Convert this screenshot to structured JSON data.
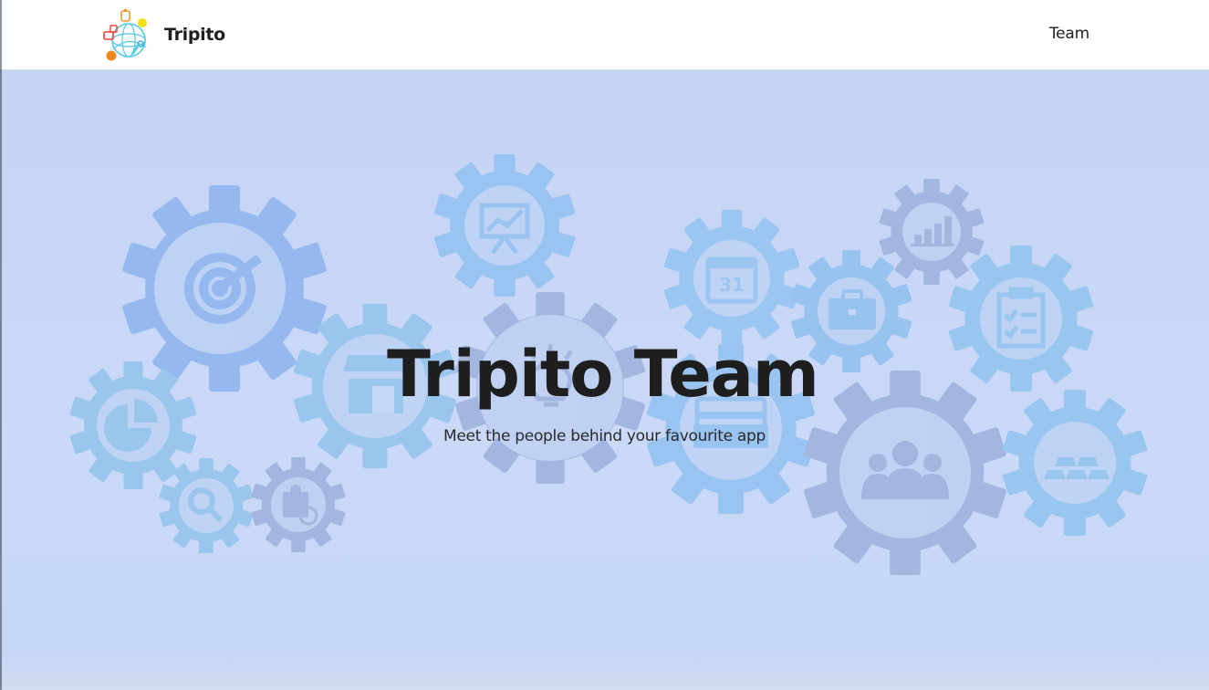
{
  "navbar": {
    "brand_name": "Tripito",
    "links": [
      {
        "label": "Team"
      }
    ]
  },
  "hero": {
    "title": "Tripito Team",
    "subtitle": "Meet the people behind your favourite app"
  },
  "colors": {
    "hero_background": "#c7d6f5",
    "gear_blue": "#94b8ee",
    "gear_sky": "#99c8ef",
    "gear_slate": "#9fb3dc",
    "text_dark": "#1e1e1e"
  },
  "background_icons": [
    "target-icon",
    "presentation-chart-icon",
    "calendar-icon",
    "bar-chart-icon",
    "briefcase-icon",
    "clipboard-checklist-icon",
    "storefront-icon",
    "lightbulb-icon",
    "credit-card-icon",
    "pie-chart-icon",
    "magnifier-icon",
    "puzzle-icon",
    "team-people-icon",
    "gold-bars-icon"
  ]
}
